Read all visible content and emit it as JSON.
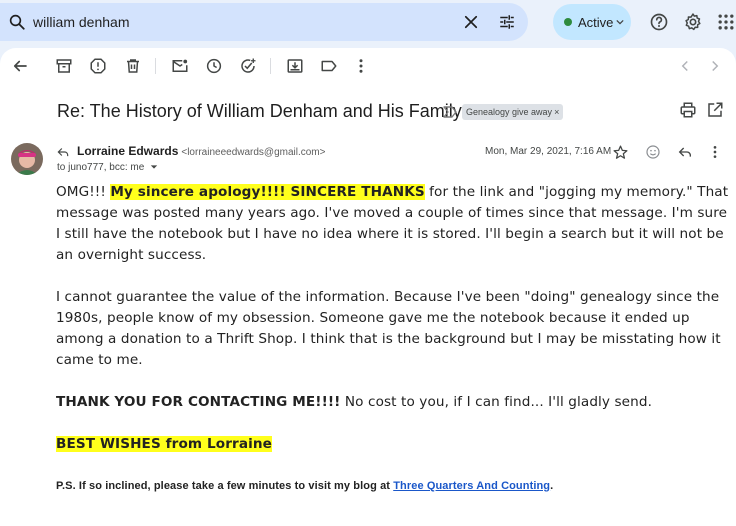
{
  "search": {
    "query": "william denham"
  },
  "status": {
    "label": "Active"
  },
  "email": {
    "subject": "Re: The History of William Denham and His Family",
    "label": "Genealogy give away",
    "label_close": "×",
    "sender_name": "Lorraine Edwards",
    "sender_email": "<lorraineeedwards@gmail.com>",
    "to_line": "to juno777, bcc: me",
    "date": "Mon, Mar 29, 2021, 7:16 AM"
  },
  "body": {
    "p1_pre": "OMG!!! ",
    "p1_hl1": "My sincere apology!!!! SINCERE THANKS",
    "p1_post": " for the link and \"jogging my memory.\" That message was posted many years ago. I've moved a couple of times since that message. I'm sure I still have the notebook but I have no idea where it is stored. I'll begin a search but it will not be an overnight success.",
    "p2": "I cannot guarantee the value of the information. Because I've been \"doing\" genealogy since the 1980s, people know of my obsession. Someone gave me the notebook because it ended up among a donation to a Thrift Shop. I think that is the background but I may be misstating how it came to me.",
    "p3_bold": "THANK YOU FOR CONTACTING ME!!!!",
    "p3_rest": " No cost to you, if I can find... I'll gladly send.",
    "p4_hl": "BEST WISHES from Lorraine",
    "ps_pre": "P.S.  If so inclined, please take a few minutes to visit my blog at ",
    "ps_link": "Three Quarters And Counting",
    "ps_post": "."
  },
  "colors": {
    "highlight": "#ffff1c",
    "link": "#1a57c9",
    "status_dot": "#2e8b3e"
  }
}
